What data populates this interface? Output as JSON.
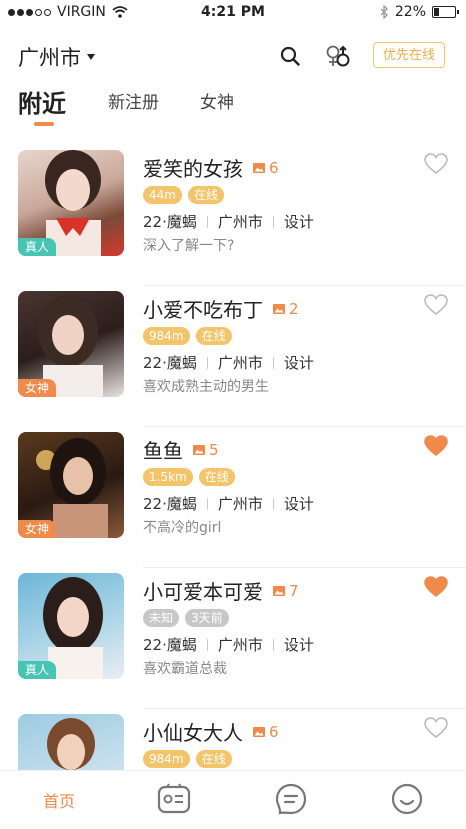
{
  "status_bar": {
    "carrier": "VIRGIN",
    "time": "4:21 PM",
    "battery": "22%"
  },
  "top_bar": {
    "city": "广州市",
    "priority_label": "优先在线"
  },
  "tabs": [
    {
      "label": "附近",
      "active": true
    },
    {
      "label": "新注册",
      "active": false
    },
    {
      "label": "女神",
      "active": false
    }
  ],
  "users": [
    {
      "name": "爱笑的女孩",
      "photos": "6",
      "avatar_tag": "真人",
      "badges": [
        "44m",
        "在线"
      ],
      "age_sign": "22·魔蝎",
      "city": "广州市",
      "job": "设计",
      "bio": "深入了解一下?",
      "liked": false
    },
    {
      "name": "小爱不吃布丁",
      "photos": "2",
      "avatar_tag": "女神",
      "badges": [
        "984m",
        "在线"
      ],
      "age_sign": "22·魔蝎",
      "city": "广州市",
      "job": "设计",
      "bio": "喜欢成熟主动的男生",
      "liked": false
    },
    {
      "name": "鱼鱼",
      "photos": "5",
      "avatar_tag": "女神",
      "badges": [
        "1.5km",
        "在线"
      ],
      "age_sign": "22·魔蝎",
      "city": "广州市",
      "job": "设计",
      "bio": "不高冷的girl",
      "liked": true
    },
    {
      "name": "小可爱本可爱",
      "photos": "7",
      "avatar_tag": "真人",
      "badges": [
        "未知",
        "3天前"
      ],
      "age_sign": "22·魔蝎",
      "city": "广州市",
      "job": "设计",
      "bio": "喜欢霸道总裁",
      "liked": true
    },
    {
      "name": "小仙女大人",
      "photos": "6",
      "avatar_tag": "",
      "badges": [
        "984m",
        "在线"
      ],
      "age_sign": "",
      "city": "",
      "job": "",
      "bio": "",
      "liked": false
    }
  ],
  "tab_bar": {
    "home_label": "首页"
  },
  "colors": {
    "accent": "#f08a4b",
    "badge": "#f3c46a",
    "real_tag": "#47c4b4",
    "badge_gray": "#c7c7c7"
  }
}
